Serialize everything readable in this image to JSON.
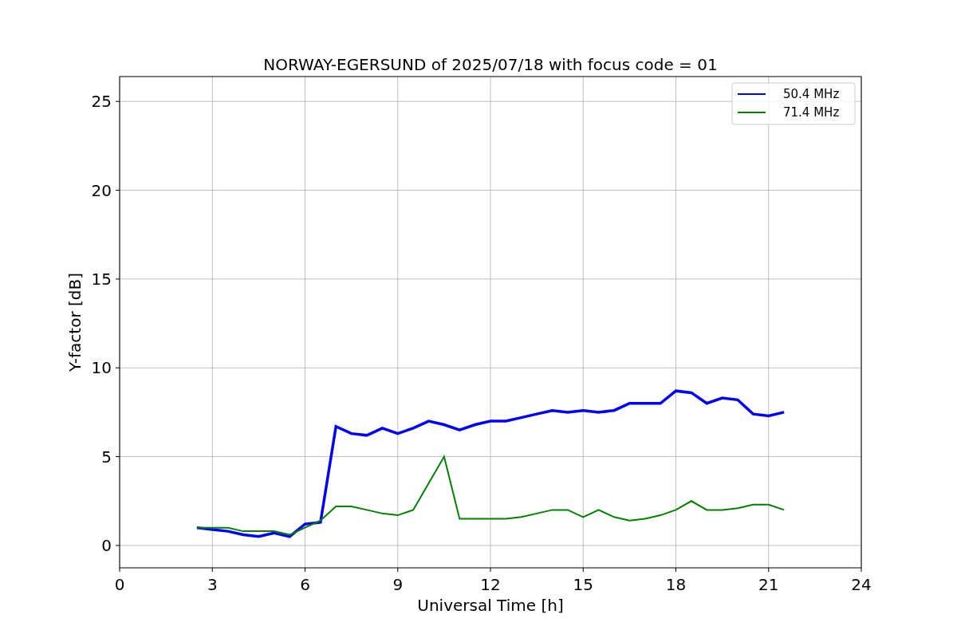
{
  "figure": {
    "chart_data": {
      "type": "line",
      "title": "NORWAY-EGERSUND of 2025/07/18 with focus code = 01",
      "xlabel": "Universal Time [h]",
      "ylabel": "Y-factor [dB]",
      "x": [
        2.5,
        3,
        3.5,
        4,
        4.5,
        5,
        5.5,
        6,
        6.5,
        7,
        7.5,
        8,
        8.5,
        9,
        9.5,
        10,
        10.5,
        11,
        11.5,
        12,
        12.5,
        13,
        13.5,
        14,
        14.5,
        15,
        15.5,
        16,
        16.5,
        17,
        17.5,
        18,
        18.5,
        19,
        19.5,
        20,
        20.5,
        21,
        21.5
      ],
      "series": [
        {
          "name": "50.4 MHz",
          "color": "#0000ff",
          "values": [
            1.0,
            0.9,
            0.8,
            0.6,
            0.5,
            0.7,
            0.5,
            1.2,
            1.3,
            6.7,
            6.3,
            6.2,
            6.6,
            6.3,
            6.6,
            7.0,
            6.8,
            6.5,
            6.8,
            7.0,
            7.0,
            7.2,
            7.4,
            7.6,
            7.5,
            7.6,
            7.5,
            7.6,
            8.0,
            8.0,
            8.0,
            8.7,
            8.6,
            8.0,
            8.3,
            8.2,
            7.4,
            7.3,
            7.5
          ]
        },
        {
          "name": "71.4 MHz",
          "color": "#008000",
          "values": [
            1.0,
            1.0,
            1.0,
            0.8,
            0.8,
            0.8,
            0.6,
            1.0,
            1.4,
            2.2,
            2.2,
            2.0,
            1.8,
            1.7,
            2.0,
            3.5,
            5.0,
            1.5,
            1.5,
            1.5,
            1.5,
            1.6,
            1.8,
            2.0,
            2.0,
            1.6,
            2.0,
            1.6,
            1.4,
            1.5,
            1.7,
            2.0,
            2.5,
            2.0,
            2.0,
            2.1,
            2.3,
            2.3,
            2.0
          ]
        }
      ],
      "grid": true,
      "legend": true,
      "xlim": [
        0,
        24
      ],
      "ylim": [
        -1.26,
        26.4
      ],
      "xticks": [
        0,
        3,
        6,
        9,
        12,
        15,
        18,
        21,
        24
      ],
      "yticks": [
        0,
        5,
        10,
        15,
        20,
        25
      ]
    }
  }
}
